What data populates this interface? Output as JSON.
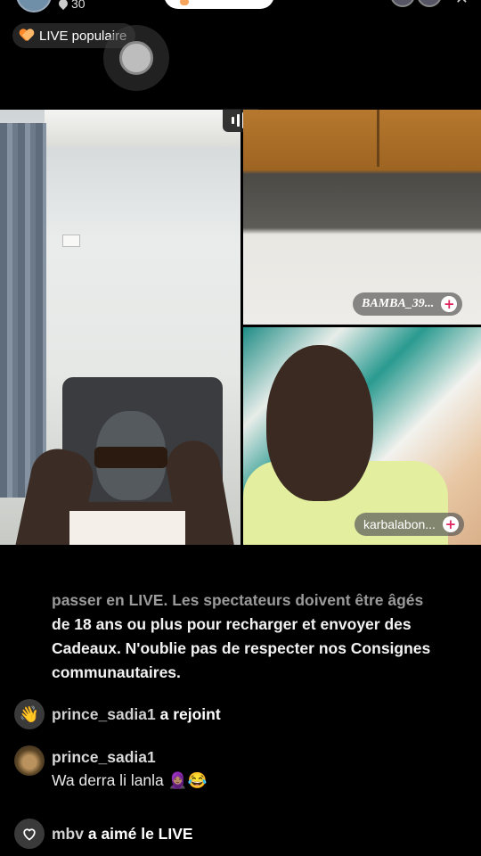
{
  "header": {
    "viewer_count": "30",
    "live_badge": "LIVE populaire"
  },
  "guests": [
    {
      "name": "BAMBA_39..."
    },
    {
      "name": "karbalabon..."
    }
  ],
  "system_message": {
    "faded_line": "passer en LIVE. Les spectateurs doivent être âgés",
    "body": "de 18 ans ou plus pour recharger et envoyer des Cadeaux. N'oublie pas de respecter nos Consignes communautaires."
  },
  "chat": [
    {
      "user": "prince_sadia1",
      "action": "a rejoint",
      "icon": "wave-icon"
    },
    {
      "user": "prince_sadia1",
      "message": "Wa derra li lanla 🧕🏽😂",
      "icon": "user-avatar"
    },
    {
      "user": "mbv",
      "action": "a aimé le LIVE",
      "icon": "heart-outline-icon"
    }
  ],
  "colors": {
    "background": "#000000",
    "badge_heart": "#ff8a2b",
    "plus_accent": "#e0245e"
  }
}
